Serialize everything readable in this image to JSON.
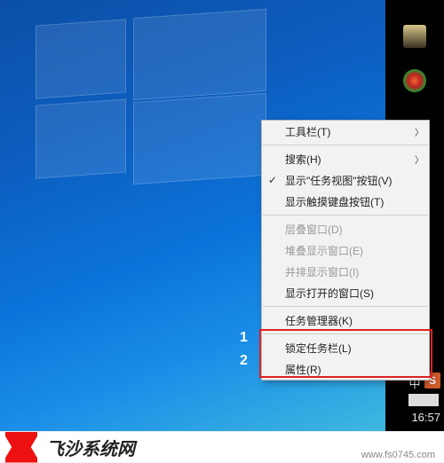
{
  "menu": {
    "toolbar": "工具栏(T)",
    "search": "搜索(H)",
    "show_task_view": "显示\"任务视图\"按钮(V)",
    "show_touch_kb": "显示触摸键盘按钮(T)",
    "cascade": "层叠窗口(D)",
    "stacked": "堆叠显示窗口(E)",
    "sidebyside": "并排显示窗口(I)",
    "show_open": "显示打开的窗口(S)",
    "task_manager": "任务管理器(K)",
    "lock_taskbar": "锁定任务栏(L)",
    "properties": "属性(R)"
  },
  "annotation": {
    "n1": "1",
    "n2": "2"
  },
  "tray": {
    "ime": "中",
    "sogou": "S",
    "clock": "16:57"
  },
  "footer": {
    "brand": "飞沙系统网",
    "url": "www.fs0745.com"
  }
}
